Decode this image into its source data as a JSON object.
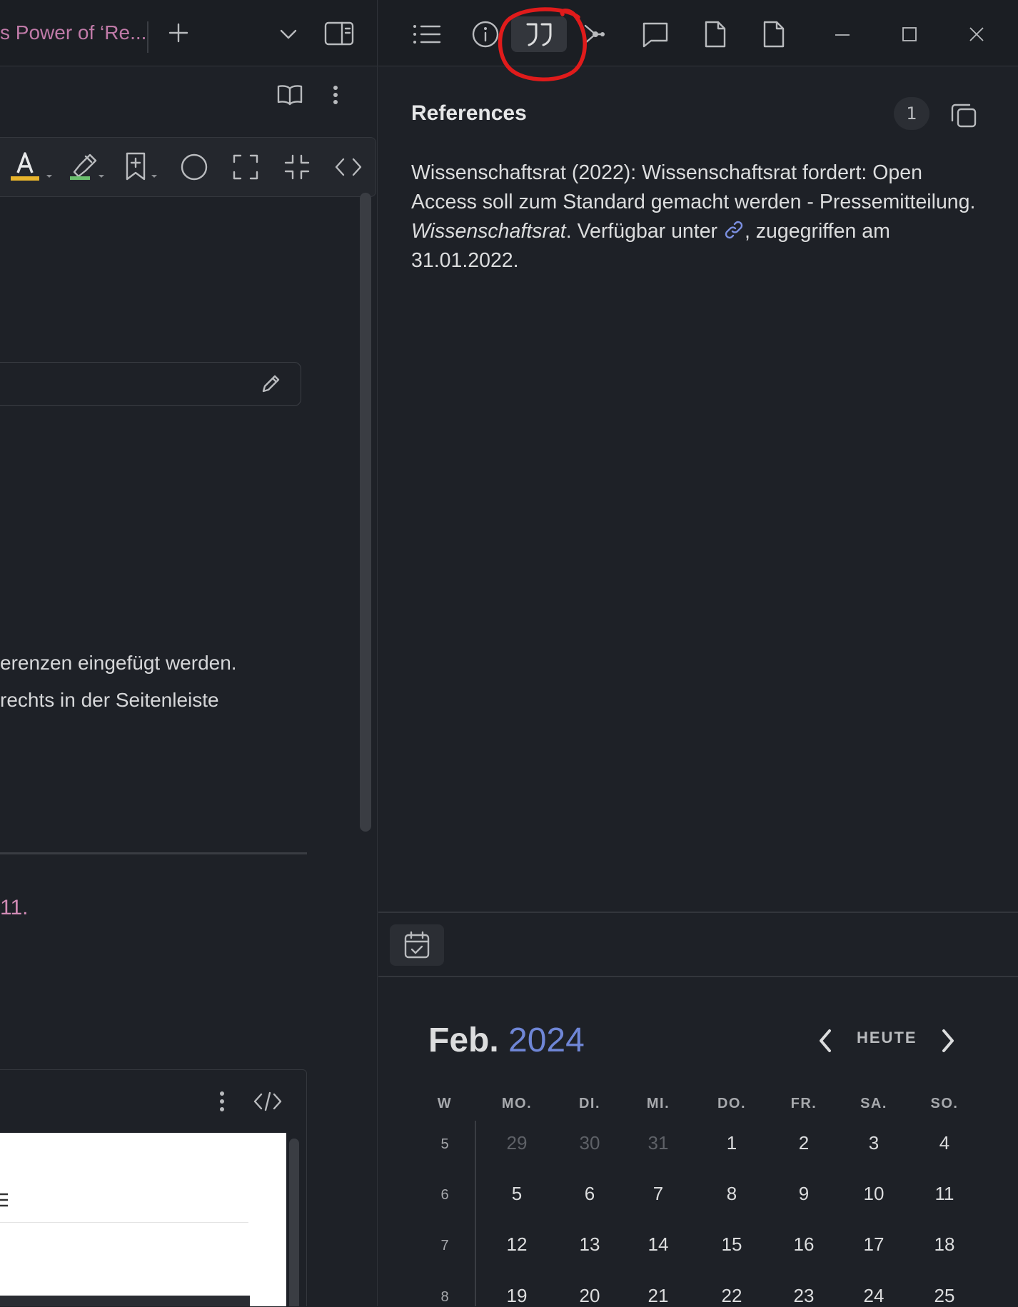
{
  "left_pane": {
    "tab_title": "s Power of ‘Re...",
    "body_lines": [
      "erenzen eingefügt werden.",
      "rechts in der Seitenleiste"
    ],
    "pink_fragment": "11."
  },
  "right_pane": {
    "references": {
      "title": "References",
      "count": "1",
      "citation": {
        "part1": "Wissenschaftsrat (2022): Wissenschaftsrat fordert: Open Access soll zum Standard gemacht werden - Pressemitteilung. ",
        "journal": "Wissenschaftsrat",
        "part2": ". Verfügbar unter ",
        "part3": ", zugegriffen am 31.01.2022."
      }
    },
    "calendar": {
      "month": "Feb.",
      "year": "2024",
      "today_label": "HEUTE",
      "headers": [
        "W",
        "MO.",
        "DI.",
        "MI.",
        "DO.",
        "FR.",
        "SA.",
        "SO."
      ],
      "weeks": [
        {
          "week": "5",
          "days": [
            "29",
            "30",
            "31",
            "1",
            "2",
            "3",
            "4"
          ],
          "muted": [
            true,
            true,
            true,
            false,
            false,
            false,
            false
          ]
        },
        {
          "week": "6",
          "days": [
            "5",
            "6",
            "7",
            "8",
            "9",
            "10",
            "11"
          ],
          "muted": [
            false,
            false,
            false,
            false,
            false,
            false,
            false
          ]
        },
        {
          "week": "7",
          "days": [
            "12",
            "13",
            "14",
            "15",
            "16",
            "17",
            "18"
          ],
          "muted": [
            false,
            false,
            false,
            false,
            false,
            false,
            false
          ]
        },
        {
          "week": "8",
          "days": [
            "19",
            "20",
            "21",
            "22",
            "23",
            "24",
            "25"
          ],
          "muted": [
            false,
            false,
            false,
            false,
            false,
            false,
            false
          ]
        }
      ]
    }
  },
  "colors": {
    "background": "#1e2127",
    "accent_year": "#6f86d6",
    "tab_pink": "#c07aa8",
    "annotation_red": "#e01b1b"
  }
}
